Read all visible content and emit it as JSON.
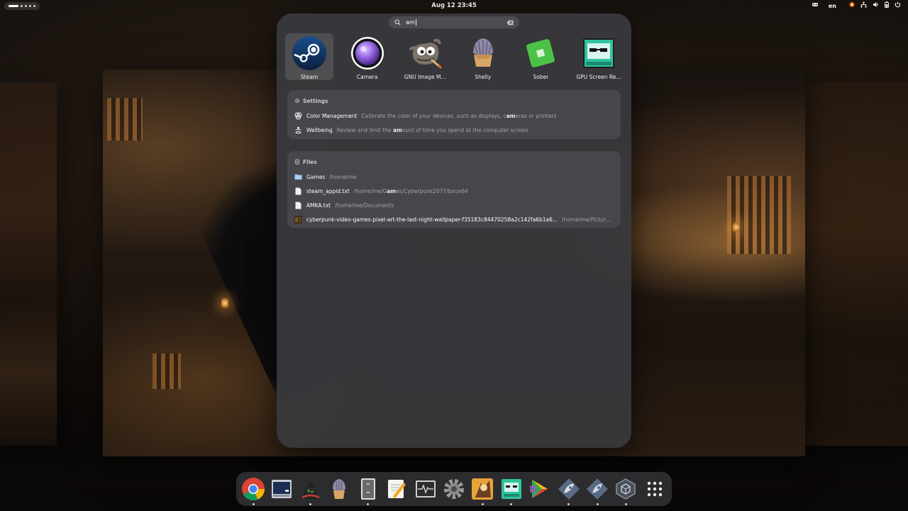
{
  "topbar": {
    "clock": "Aug 12  23:45",
    "language": "en",
    "icons": [
      "accessibility-icon",
      "network-icon",
      "volume-icon",
      "battery-icon",
      "power-icon"
    ]
  },
  "search": {
    "query": "am"
  },
  "apps": [
    {
      "label": "Steam",
      "icon": "steam-icon",
      "selected": true
    },
    {
      "label": "Camera",
      "icon": "camera-icon"
    },
    {
      "label": "GNU Image M...",
      "icon": "gimp-icon"
    },
    {
      "label": "Shelly",
      "icon": "shelly-icon"
    },
    {
      "label": "Sober",
      "icon": "sober-icon"
    },
    {
      "label": "GPU Screen Re...",
      "icon": "gpu-screen-recorder-icon"
    }
  ],
  "settings": {
    "title": "Settings",
    "items": [
      {
        "name": "Color Management",
        "desc_before": "Calibrate the color of your devices, such as displays, c",
        "desc_match": "am",
        "desc_after": "eras or printers"
      },
      {
        "name": "Wellbeing",
        "desc_before": "Review and limit the ",
        "desc_match": "am",
        "desc_after": "ount of time you spend at the computer screen"
      }
    ]
  },
  "files": {
    "title": "Files",
    "items": [
      {
        "name": "Games",
        "path": "/home/me",
        "icon": "folder-icon"
      },
      {
        "name": "steam_appid.txt",
        "path_before": "/home/me/G",
        "path_match": "am",
        "path_after": "es/Cyberpunk2077/bin/x64",
        "icon": "text-file-icon"
      },
      {
        "name": "AMKA.txt",
        "path": "/home/me/Documents",
        "icon": "text-file-icon"
      },
      {
        "name": "cyberpunk-video-games-pixel-art-the-last-night-wallpaper-f35183c84470258a2c142fa6b1a6...",
        "path": "/home/me/Pictures/Walls",
        "icon": "image-thumbnail-icon"
      }
    ]
  },
  "dock": [
    {
      "name": "chrome",
      "running": true
    },
    {
      "name": "terminal-app",
      "running": false
    },
    {
      "name": "hacker-app",
      "running": true
    },
    {
      "name": "shelly-dock",
      "running": false
    },
    {
      "name": "files-app",
      "running": true
    },
    {
      "name": "text-editor",
      "running": false
    },
    {
      "name": "system-monitor",
      "running": false
    },
    {
      "name": "settings-app",
      "running": false
    },
    {
      "name": "game-app",
      "running": true
    },
    {
      "name": "gpu-recorder-dock",
      "running": true
    },
    {
      "name": "play-store-app",
      "running": false
    },
    {
      "name": "rocket-app-1",
      "running": true
    },
    {
      "name": "rocket-app-2",
      "running": true
    },
    {
      "name": "godot-app",
      "running": true
    },
    {
      "name": "app-grid",
      "running": false
    }
  ],
  "colors": {
    "panel": "#38383c",
    "card": "#46464b",
    "accent": "#3584e4"
  }
}
